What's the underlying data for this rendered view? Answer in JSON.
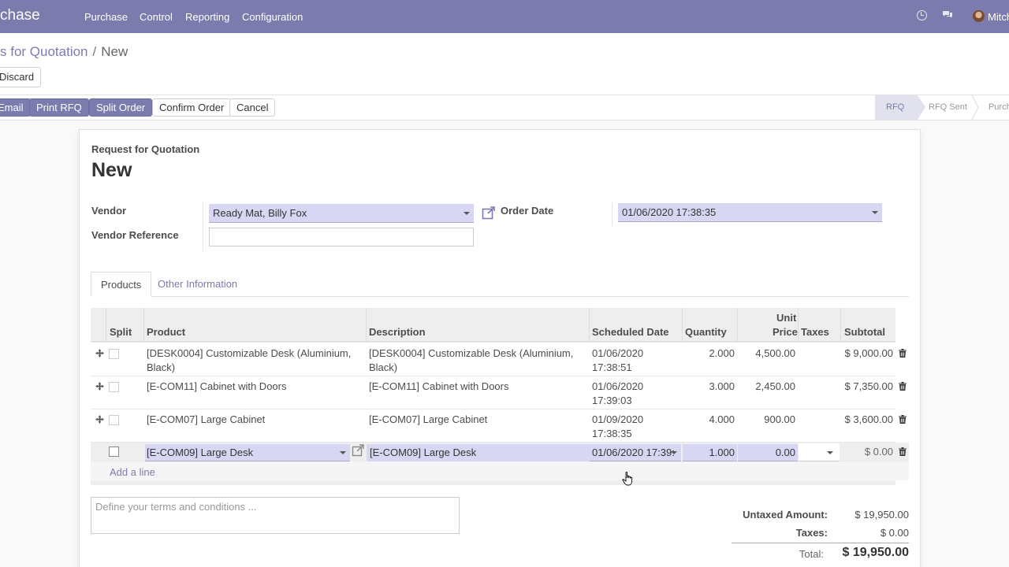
{
  "navbar": {
    "app_name": "chase",
    "menu": [
      "Purchase",
      "Control",
      "Reporting",
      "Configuration"
    ],
    "user_name": "Mitch"
  },
  "breadcrumb": {
    "parent": "s for Quotation",
    "separator": "/",
    "current": "New"
  },
  "buttons": {
    "discard": "Discard",
    "email": "Email",
    "print_rfq": "Print RFQ",
    "split_order": "Split Order",
    "confirm_order": "Confirm Order",
    "cancel": "Cancel"
  },
  "status_stages": [
    "RFQ",
    "RFQ Sent",
    "Purch"
  ],
  "active_stage": "RFQ",
  "form": {
    "doc_type": "Request for Quotation",
    "title": "New",
    "vendor_label": "Vendor",
    "vendor_value": "Ready Mat, Billy Fox",
    "vendor_reference_label": "Vendor Reference",
    "vendor_reference_value": "",
    "order_date_label": "Order Date",
    "order_date_value": "01/06/2020 17:38:35"
  },
  "tabs": [
    "Products",
    "Other Information"
  ],
  "table": {
    "headers": {
      "split": "Split",
      "product": "Product",
      "description": "Description",
      "scheduled_date": "Scheduled Date",
      "quantity": "Quantity",
      "unit_price_1": "Unit",
      "unit_price_2": "Price",
      "taxes": "Taxes",
      "subtotal": "Subtotal"
    },
    "rows": [
      {
        "product_1": "[DESK0004] Customizable Desk (Aluminium,",
        "product_2": "Black)",
        "description_1": "[DESK0004] Customizable Desk (Aluminium,",
        "description_2": "Black)",
        "date_1": "01/06/2020",
        "date_2": "17:38:51",
        "quantity": "2.000",
        "unit_price": "4,500.00",
        "subtotal": "$ 9,000.00"
      },
      {
        "product_1": "[E-COM11] Cabinet with Doors",
        "product_2": "",
        "description_1": "[E-COM11] Cabinet with Doors",
        "description_2": "",
        "date_1": "01/06/2020",
        "date_2": "17:39:03",
        "quantity": "3.000",
        "unit_price": "2,450.00",
        "subtotal": "$ 7,350.00"
      },
      {
        "product_1": "[E-COM07] Large Cabinet",
        "product_2": "",
        "description_1": "[E-COM07] Large Cabinet",
        "description_2": "",
        "date_1": "01/09/2020",
        "date_2": "17:38:35",
        "quantity": "4.000",
        "unit_price": "900.00",
        "subtotal": "$ 3,600.00"
      }
    ],
    "edit_row": {
      "product": "[E-COM09] Large Desk",
      "description": "[E-COM09] Large Desk",
      "scheduled_date": "01/06/2020 17:39:",
      "quantity": "1.000",
      "unit_price": "0.00",
      "subtotal": "$ 0.00"
    },
    "add_line": "Add a line"
  },
  "terms_placeholder": "Define your terms and conditions ...",
  "totals": {
    "untaxed_label": "Untaxed Amount:",
    "untaxed_value": "$ 19,950.00",
    "taxes_label": "Taxes:",
    "taxes_value": "$ 0.00",
    "total_label": "Total:",
    "total_value": "$ 19,950.00"
  },
  "colors": {
    "brand": "#7c7bad",
    "field_bg": "#d8d7f3"
  }
}
